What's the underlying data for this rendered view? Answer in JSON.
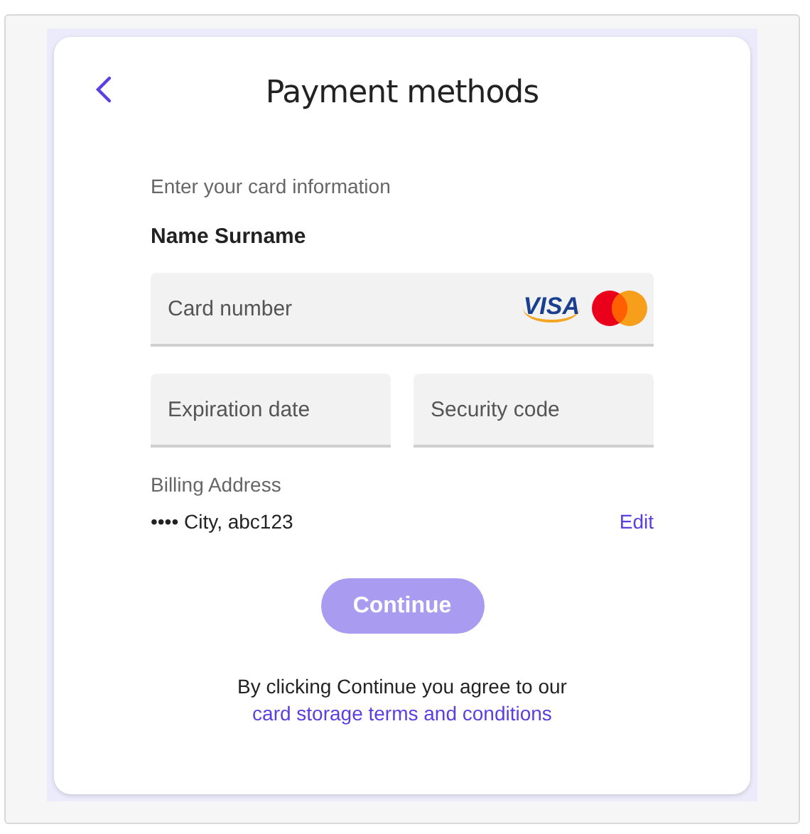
{
  "header": {
    "title": "Payment methods"
  },
  "form": {
    "intro": "Enter your card information",
    "cardholder": "Name Surname",
    "fields": [
      {
        "kind": "card",
        "placeholder": "Card number",
        "brand": "VISA"
      },
      {
        "kind": "half",
        "placeholder": "Expiration date"
      },
      {
        "kind": "half",
        "placeholder": "Security code"
      }
    ],
    "billing": {
      "label": "Billing Address",
      "value": "•••• City, abc123",
      "action": "Edit"
    }
  },
  "continue_button": {
    "label": "Continue",
    "disabled": true
  },
  "agreement": {
    "text": "By clicking Continue you agree to our",
    "link": "card storage terms and conditions"
  }
}
